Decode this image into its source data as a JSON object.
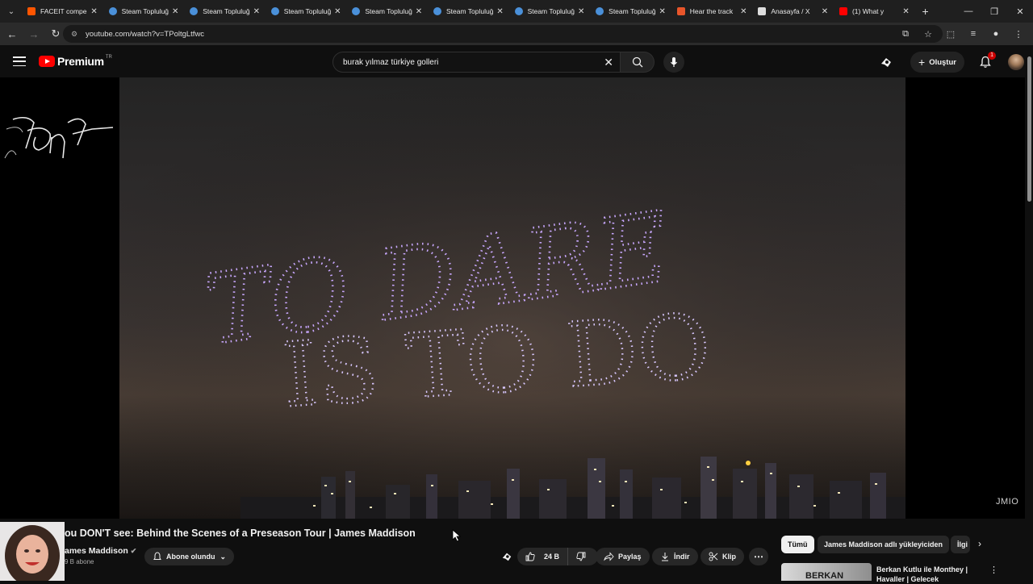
{
  "browser": {
    "tabs": [
      {
        "title": "FACEIT compe",
        "favicon": "faceit",
        "color": "#ff5500"
      },
      {
        "title": "Steam Topluluğ",
        "favicon": "steam",
        "color": "#4a90d9"
      },
      {
        "title": "Steam Topluluğ",
        "favicon": "steam",
        "color": "#4a90d9"
      },
      {
        "title": "Steam Topluluğ",
        "favicon": "steam",
        "color": "#4a90d9"
      },
      {
        "title": "Steam Topluluğ",
        "favicon": "steam",
        "color": "#4a90d9"
      },
      {
        "title": "Steam Topluluğ",
        "favicon": "steam",
        "color": "#4a90d9"
      },
      {
        "title": "Steam Topluluğ",
        "favicon": "steam",
        "color": "#4a90d9"
      },
      {
        "title": "Steam Topluluğ",
        "favicon": "steam",
        "color": "#4a90d9"
      },
      {
        "title": "Hear the track",
        "favicon": "music",
        "color": "#e8552a"
      },
      {
        "title": "Anasayfa / X",
        "favicon": "x",
        "color": "#dddddd"
      },
      {
        "title": "(1) What y",
        "favicon": "youtube",
        "color": "#ff0000"
      }
    ],
    "url": "youtube.com/watch?v=TPoltgLtfwc"
  },
  "youtube": {
    "logo_text": "Premium",
    "region": "TR",
    "search_query": "burak yılmaz türkiye golleri",
    "create_label": "Oluştur",
    "notification_count": "1",
    "video_title": "ou DON'T see: Behind the Scenes of a Preseason Tour | James Maddison",
    "channel_name": "ames Maddison",
    "subscribers": "9 B abone",
    "subscribed_label": "Abone olundu",
    "like_count": "24 B",
    "share_label": "Paylaş",
    "download_label": "İndir",
    "clip_label": "Klip",
    "chips": [
      "Tümü",
      "James Maddison adlı yükleyiciden",
      "İlgi"
    ],
    "recommended": {
      "title": "Berkan Kutlu ile Monthey | Havaller | Gelecek",
      "thumb_text": "BERKAN"
    },
    "video_overlay": {
      "drone_text_line1": "TO DARE",
      "drone_text_line2": "IS TO DO",
      "corner_watermark": "JMIO"
    }
  }
}
